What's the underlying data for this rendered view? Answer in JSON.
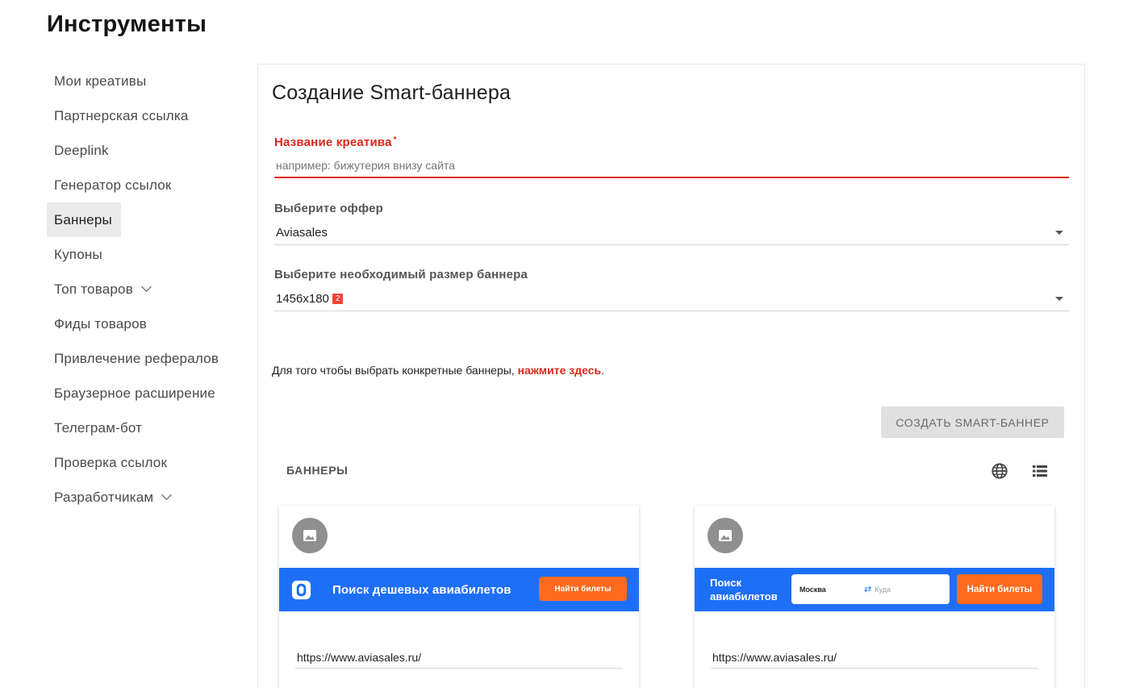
{
  "page": {
    "title": "Инструменты"
  },
  "sidebar": {
    "items": [
      {
        "label": "Мои креативы"
      },
      {
        "label": "Партнерская ссылка"
      },
      {
        "label": "Deeplink"
      },
      {
        "label": "Генератор ссылок"
      },
      {
        "label": "Баннеры",
        "active": true
      },
      {
        "label": "Купоны"
      },
      {
        "label": "Топ товаров",
        "expandable": true
      },
      {
        "label": "Фиды товаров"
      },
      {
        "label": "Привлечение рефералов"
      },
      {
        "label": "Браузерное расширение"
      },
      {
        "label": "Телеграм-бот"
      },
      {
        "label": "Проверка ссылок"
      },
      {
        "label": "Разработчикам",
        "expandable": true
      }
    ]
  },
  "form": {
    "title": "Создание Smart-баннера",
    "name_field": {
      "label": "Название креатива",
      "required_mark": "*",
      "placeholder": "например: бижутерия внизу сайта"
    },
    "offer_field": {
      "label": "Выберите оффер",
      "value": "Aviasales"
    },
    "size_field": {
      "label": "Выберите необходимый размер баннера",
      "value": "1456x180",
      "badge": "2"
    },
    "hint": {
      "text": "Для того чтобы выбрать конкретные баннеры, ",
      "link": "нажмите здесь",
      "suffix": "."
    },
    "create_button": "СОЗДАТЬ SMART-БАННЕР"
  },
  "banners": {
    "section_title": "БАННЕРЫ",
    "icons": [
      "globe-icon",
      "list-view-icon"
    ],
    "cards": [
      {
        "banner_text": "Поиск дешевых авиабилетов",
        "button": "Найти билеты",
        "url": "https://www.aviasales.ru/"
      },
      {
        "banner_text": "Поиск авиабилетов",
        "from": "Москва",
        "to": "Куда",
        "button": "Найти билеты",
        "url": "https://www.aviasales.ru/"
      }
    ]
  },
  "colors": {
    "accent_red": "#e0261b",
    "banner_blue": "#1e6ff7",
    "banner_orange": "#ff6a1f"
  }
}
